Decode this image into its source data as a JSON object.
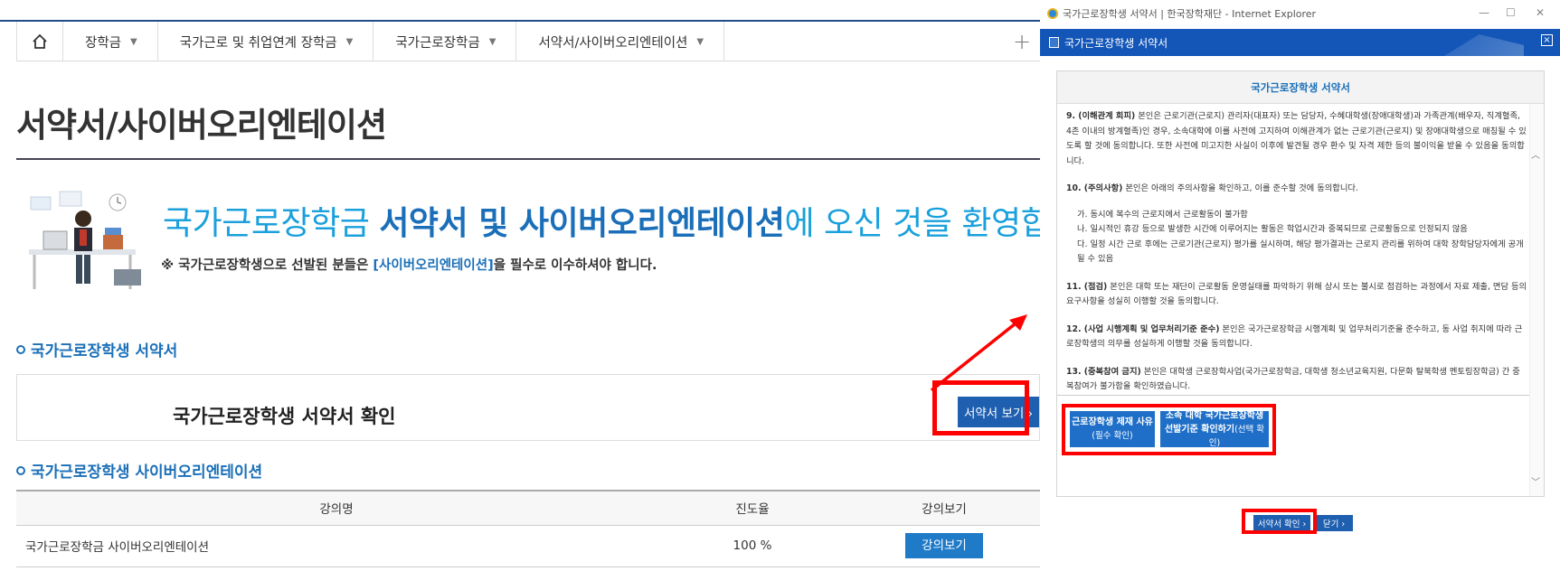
{
  "nav": {
    "items": [
      {
        "label": "장학금"
      },
      {
        "label": "국가근로 및 취업연계 장학금"
      },
      {
        "label": "국가근로장학금"
      },
      {
        "label": "서약서/사이버오리엔테이션"
      }
    ],
    "plus": "+"
  },
  "page": {
    "title": "서약서/사이버오리엔테이션",
    "welcome_prefix": "국가근로장학금 ",
    "welcome_bold": "서약서 및 사이버오리엔테이션",
    "welcome_suffix": "에 오신 것을 환영합니다",
    "note_prefix": "※ 국가근로장학생으로 선발된 분들은 ",
    "note_highlight": "[사이버오리엔테이션]",
    "note_suffix": "을 필수로 이수하셔야 합니다."
  },
  "pledge_section": {
    "title": "국가근로장학생 서약서",
    "label": "국가근로장학생 서약서 확인",
    "button": "서약서 보기 ›"
  },
  "orientation_section": {
    "title": "국가근로장학생 사이버오리엔테이션",
    "columns": [
      "강의명",
      "진도율",
      "강의보기"
    ],
    "rows": [
      {
        "name": "국가근로장학금 사이버오리엔테이션",
        "progress": "100 %",
        "action": "강의보기"
      }
    ]
  },
  "popup": {
    "window_title": "국가근로장학생 서약서 | 한국장학재단 - Internet Explorer",
    "header": "국가근로장학생 서약서",
    "doc_title": "국가근로장학생 서약서",
    "clauses": [
      {
        "num": "9. (이해관계 회피)",
        "text": " 본인은 근로기관(근로지) 관리자(대표자) 또는 담당자, 수혜대학생(장애대학생)과 가족관계(배우자, 직계혈족, 4촌 이내의 방계혈족)인 경우, 소속대학에 이를 사전에 고지하여 이해관계가 없는 근로기관(근로지) 및 장애대학생으로 매칭될 수 있도록 할 것에 동의합니다. 또한 사전에 미고지한 사실이 이후에 발견될 경우 환수 및 자격 제한 등의 불이익을 받을 수 있음을 동의합니다."
      },
      {
        "num": "10. (주의사항)",
        "text": " 본인은 아래의 주의사항을 확인하고, 이를 준수할 것에 동의합니다."
      },
      {
        "num": "11. (점검)",
        "text": " 본인은 대학 또는 재단이 근로활동 운영실태를 파악하기 위해 상시 또는 불시로 점검하는 과정에서 자료 제출, 면담 등의 요구사항을 성실히 이행할 것을 동의합니다."
      },
      {
        "num": "12. (사업 시행계획 및 업무처리기준 준수)",
        "text": " 본인은 국가근로장학금 시행계획 및 업무처리기준을 준수하고, 동 사업 취지에 따라 근로장학생의 의무를 성실하게 이행할 것을 동의합니다."
      },
      {
        "num": "13. (중복참여 금지)",
        "text": " 본인은 대학생 근로장학사업(국가근로장학금, 대학생 청소년교육지원, 다문화 탈북학생 멘토링장학금) 간 중복참여가 불가함을 확인하였습니다."
      }
    ],
    "sub_items": [
      "가. 동시에 복수의 근로지에서 근로활동이 불가함",
      "나. 일시적인 휴강 등으로 발생한 시간에 이루어지는 활동은 학업시간과 중복되므로 근로활동으로 인정되지 않음",
      "다. 일정 시간 근로 후에는 근로기관(근로지) 평가를 실시하며, 해당 평가결과는 근로지 관리를 위하여 대학 장학담당자에게 공개될 수 있음"
    ],
    "btn_reason_line1": "근로장학생 제재 사유",
    "btn_reason_line2": "(필수 확인)",
    "btn_criteria_line1": "소속 대학 국가근로장학생",
    "btn_criteria_line2_bold": "선발기준 확인하기",
    "btn_criteria_line2_small": "(선택 확인)",
    "confirm": "서약서 확인 ›",
    "close": "닫기 ›"
  },
  "colors": {
    "brand_blue": "#1a6fb8",
    "button_blue": "#1f5fb0",
    "highlight_red": "#ff0000",
    "welcome_cyan": "#1aa0dc"
  }
}
